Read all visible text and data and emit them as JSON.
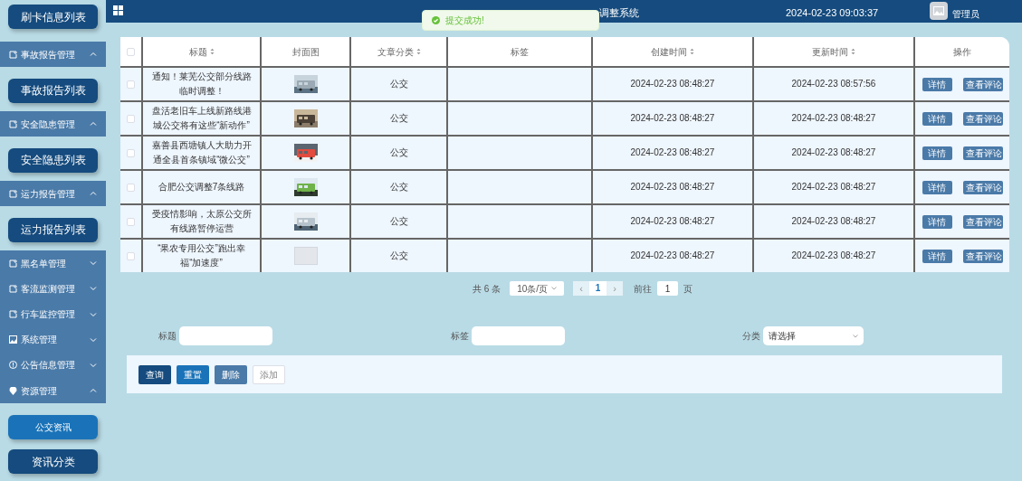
{
  "sidebar": {
    "items": [
      {
        "kind": "button",
        "label": "刷卡信息列表",
        "selected": false
      },
      {
        "kind": "group",
        "label": "事故报告管理",
        "expanded": true
      },
      {
        "kind": "button",
        "label": "事故报告列表",
        "selected": false
      },
      {
        "kind": "group",
        "label": "安全隐患管理",
        "expanded": true
      },
      {
        "kind": "button",
        "label": "安全隐患列表",
        "selected": false
      },
      {
        "kind": "group",
        "label": "运力报告管理",
        "expanded": true
      },
      {
        "kind": "button",
        "label": "运力报告列表",
        "selected": false
      },
      {
        "kind": "group",
        "label": "黑名单管理",
        "expanded": false
      },
      {
        "kind": "group",
        "label": "客流监测管理",
        "expanded": false
      },
      {
        "kind": "group",
        "label": "行车监控管理",
        "expanded": false
      },
      {
        "kind": "group",
        "label": "系统管理",
        "expanded": false
      },
      {
        "kind": "group",
        "label": "公告信息管理",
        "expanded": false
      },
      {
        "kind": "group",
        "label": "资源管理",
        "expanded": true
      },
      {
        "kind": "button",
        "label": "公交资讯",
        "selected": true
      },
      {
        "kind": "button",
        "label": "资讯分类",
        "selected": false
      }
    ]
  },
  "header": {
    "title": "调整系统",
    "datetime": "2024-02-23 09:03:37",
    "user": "管理员"
  },
  "toast": {
    "message": "提交成功!"
  },
  "table": {
    "all_checked": false,
    "columns": [
      {
        "label": "标题",
        "sortable": true
      },
      {
        "label": "封面图",
        "sortable": false
      },
      {
        "label": "文章分类",
        "sortable": true
      },
      {
        "label": "标签",
        "sortable": false
      },
      {
        "label": "创建时间",
        "sortable": true
      },
      {
        "label": "更新时间",
        "sortable": true
      },
      {
        "label": "操作",
        "sortable": false
      }
    ],
    "rows": [
      {
        "checked": false,
        "title": "通知！莱芜公交部分线路临时调整！",
        "cover": {
          "kind": "picture"
        },
        "category": "公交",
        "created": "2024-02-23 08:48:27",
        "updated": "2024-02-23 08:57:56",
        "actions": [
          "详情",
          "查看评论"
        ]
      },
      {
        "checked": false,
        "title": "盘活老旧车上线新路线港城公交将有这些“新动作”",
        "cover": {
          "kind": "picture"
        },
        "category": "公交",
        "created": "2024-02-23 08:48:27",
        "updated": "2024-02-23 08:48:27",
        "actions": [
          "详情",
          "查看评论"
        ]
      },
      {
        "checked": false,
        "title": "嘉善县西塘镇人大助力开通全县首条镇域“微公交”",
        "cover": {
          "kind": "picture"
        },
        "category": "公交",
        "created": "2024-02-23 08:48:27",
        "updated": "2024-02-23 08:48:27",
        "actions": [
          "详情",
          "查看评论"
        ]
      },
      {
        "checked": false,
        "title": "合肥公交调整7条线路",
        "cover": {
          "kind": "picture"
        },
        "category": "公交",
        "created": "2024-02-23 08:48:27",
        "updated": "2024-02-23 08:48:27",
        "actions": [
          "详情",
          "查看评论"
        ]
      },
      {
        "checked": false,
        "title": "受疫情影响，太原公交所有线路暂停运营",
        "cover": {
          "kind": "picture"
        },
        "category": "公交",
        "created": "2024-02-23 08:48:27",
        "updated": "2024-02-23 08:48:27",
        "actions": [
          "详情",
          "查看评论"
        ]
      },
      {
        "checked": false,
        "title": "“果农专用公交”跑出幸福“加速度”",
        "cover": {
          "kind": "blank"
        },
        "category": "公交",
        "created": "2024-02-23 08:48:27",
        "updated": "2024-02-23 08:48:27",
        "actions": [
          "详情",
          "查看评论"
        ]
      }
    ]
  },
  "pagination": {
    "total": "共 6 条",
    "page_size": "10条/页",
    "prev": "‹",
    "page": "1",
    "next": "›",
    "goto_label": "前往",
    "goto_value": "1",
    "goto_suffix": "页"
  },
  "search": {
    "fields": [
      {
        "kind": "input",
        "label": "标题"
      },
      {
        "kind": "input",
        "label": "标签"
      },
      {
        "kind": "select",
        "label": "分类",
        "placeholder": "请选择"
      }
    ]
  },
  "buttons": [
    {
      "kind": "query",
      "label": "查询"
    },
    {
      "kind": "reset",
      "label": "重置"
    },
    {
      "kind": "delete",
      "label": "删除"
    },
    {
      "kind": "add",
      "label": "添加"
    }
  ]
}
